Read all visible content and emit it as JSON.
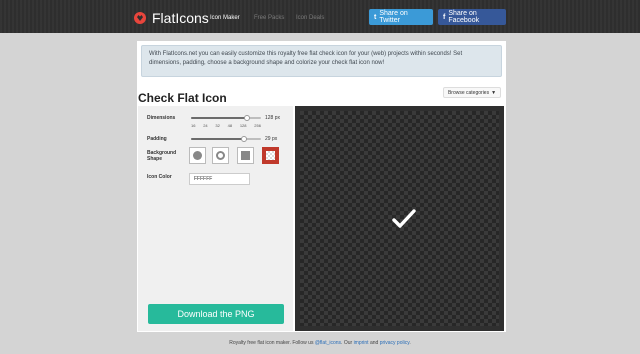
{
  "header": {
    "logo_text": "FlatIcons",
    "nav": [
      "Icon Maker",
      "Free Packs",
      "Icon Deals"
    ],
    "share_twitter": "Share on Twitter",
    "share_facebook": "Share on Facebook",
    "twitter_glyph": "t",
    "facebook_glyph": "f"
  },
  "notice": "With FlatIcons.net you can easily customize this royalty free flat check icon for your (web) projects within seconds! Set dimensions, padding, choose a background shape and colorize your check flat icon now!",
  "page_title": "Check Flat Icon",
  "browse_label": "Browse categories",
  "controls": {
    "dimensions_label": "Dimensions",
    "dimensions_value": "128 px",
    "dimensions_ticks": [
      "16",
      "24",
      "32",
      "48",
      "128",
      "256"
    ],
    "dimensions_fraction": 0.8,
    "padding_label": "Padding",
    "padding_value": "29 px",
    "padding_fraction": 0.75,
    "background_label_1": "Background",
    "background_label_2": "Shape",
    "shapes": [
      "circle",
      "circle-outline",
      "square",
      "none"
    ],
    "selected_shape": "none",
    "icon_color_label": "Icon Color",
    "icon_color_value": "FFFFFF",
    "download_label": "Download the PNG"
  },
  "colors": {
    "accent_download": "#27ba9b",
    "twitter": "#3b9ad7",
    "facebook": "#365899",
    "selected_shape": "#c0392b"
  },
  "footer": {
    "text_a": "Royalty free flat icon maker. Follow us ",
    "twitter_handle": "@flat_icons",
    "text_b": ". Our ",
    "imprint": "imprint",
    "text_c": " and ",
    "privacy": "privacy policy",
    "text_d": "."
  }
}
